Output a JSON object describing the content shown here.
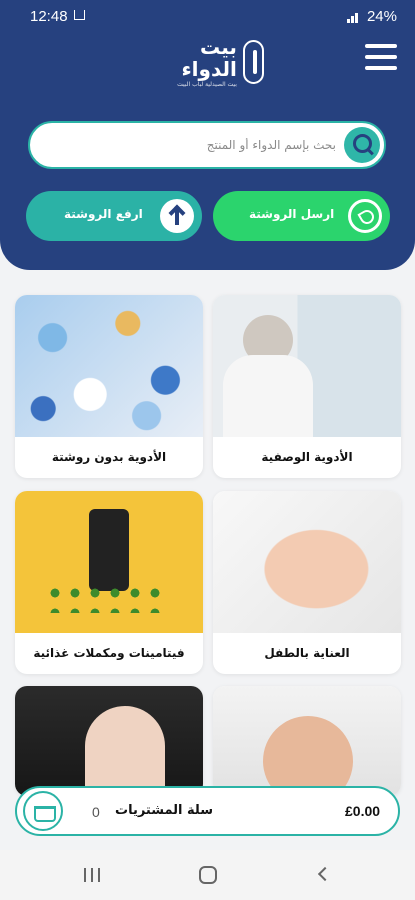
{
  "status_bar": {
    "time": "12:48",
    "battery": "24%"
  },
  "header": {
    "logo_title": "بيت الدواء",
    "logo_subtitle": "بيت الصيدلية لباب البيت",
    "search_placeholder": "بحث بإسم الدواء أو المنتج",
    "upload_label": "ارفع الروشتة",
    "send_label": "ارسل الروشتة"
  },
  "categories": [
    {
      "label": "الأدوية بدون روشتة"
    },
    {
      "label": "الأدوية الوصفية"
    },
    {
      "label": "فيتامينات ومكملات غذائية"
    },
    {
      "label": "العناية بالطفل"
    },
    {
      "label": ""
    },
    {
      "label": ""
    }
  ],
  "cart": {
    "label": "سلة المشتريات",
    "count": "0",
    "total": "£0.00"
  },
  "colors": {
    "primary": "#26417f",
    "teal": "#2bb3a6",
    "green": "#2bd46d"
  }
}
